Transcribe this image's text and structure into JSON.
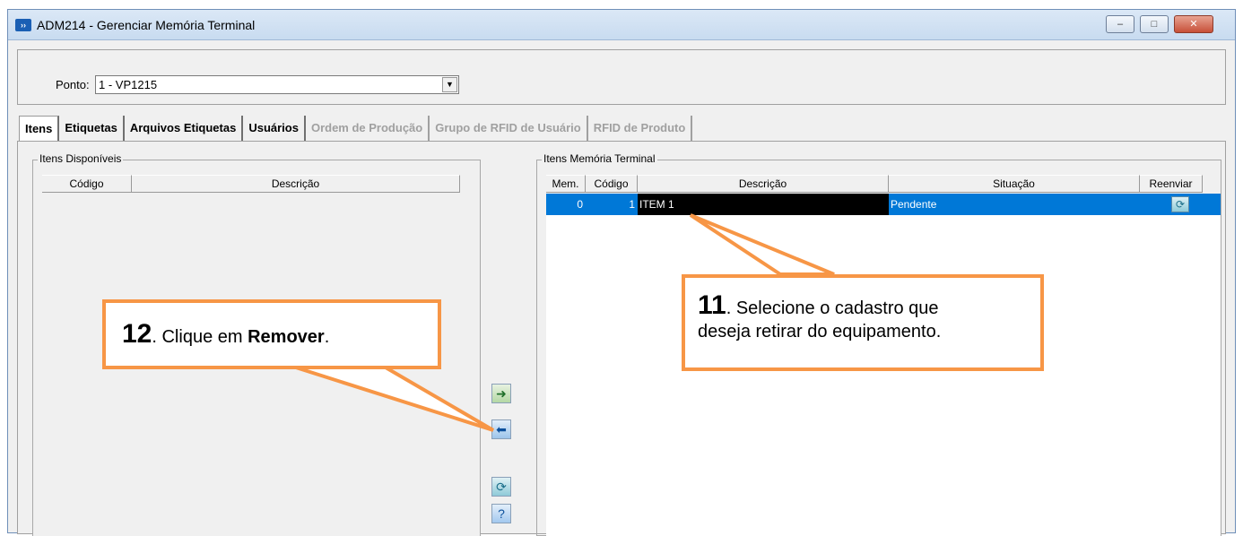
{
  "window": {
    "title": "ADM214 - Gerenciar Memória Terminal",
    "icon_label": "››",
    "buttons": {
      "minimize": "–",
      "maximize": "□",
      "close": "✕"
    }
  },
  "ponto": {
    "label": "Ponto:",
    "value": "1 - VP1215",
    "arrow": "▼"
  },
  "tabs": [
    {
      "label": "Itens"
    },
    {
      "label": "Etiquetas"
    },
    {
      "label": "Arquivos Etiquetas"
    },
    {
      "label": "Usuários"
    },
    {
      "label": "Ordem de Produção"
    },
    {
      "label": "Grupo de RFID de Usuário"
    },
    {
      "label": "RFID de Produto"
    }
  ],
  "available": {
    "legend": "Itens Disponíveis",
    "columns": [
      "Código",
      "Descrição"
    ]
  },
  "memory": {
    "legend": "Itens Memória Terminal",
    "columns": [
      "Mem.",
      "Código",
      "Descrição",
      "Situação",
      "Reenviar"
    ],
    "rows": [
      {
        "mem": "0",
        "codigo": "1",
        "descricao": "ITEM 1",
        "situacao": "Pendente",
        "reenviar_icon": "resend-icon"
      }
    ]
  },
  "side_buttons": {
    "add_icon": "arrow-right-icon",
    "remove_icon": "arrow-left-icon",
    "refresh_icon": "refresh-icon",
    "help_icon": "help-icon"
  },
  "callout_11": {
    "number": "11",
    "text_line1": ". Selecione o cadastro que",
    "text_line2": "deseja retirar do equipamento."
  },
  "callout_12": {
    "number": "12",
    "text_before": ". Clique em ",
    "text_bold": "Remover",
    "text_after": "."
  },
  "colors": {
    "accent_orange": "#f79646",
    "selection_blue": "#0078d7"
  }
}
